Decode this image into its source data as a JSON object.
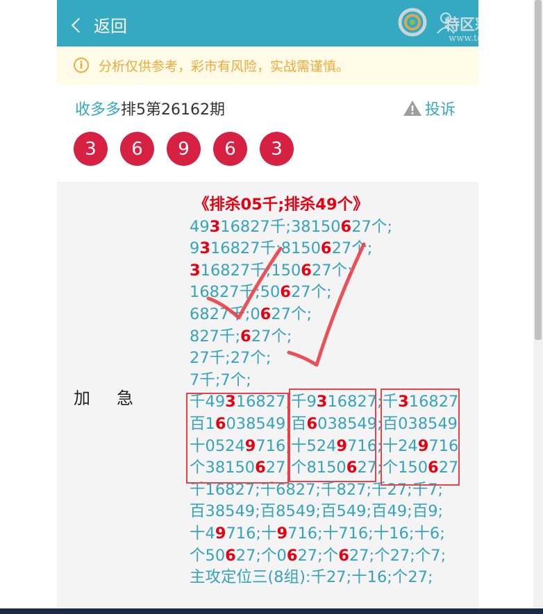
{
  "header": {
    "back_label": "返回",
    "logo_text": "特区彩票网",
    "logo_url": "www.tqcp.net"
  },
  "notice": {
    "icon": "info-icon",
    "text": "分析仅供参考，彩市有风险，实战需谨慎。"
  },
  "post": {
    "author": "收多多",
    "issue": "排5第26162期",
    "report_label": "投诉",
    "report_icon": "warning-icon"
  },
  "balls": [
    "3",
    "6",
    "9",
    "6",
    "3"
  ],
  "colors": {
    "header": "#35a9c1",
    "ball": "#d72143",
    "highlight": "#e60012",
    "text": "#36a3bb"
  },
  "content": {
    "label": "加急",
    "heading": "《排杀05千;排杀49个》",
    "lines": [
      [
        [
          "49",
          ""
        ],
        [
          "3",
          "r"
        ],
        [
          "16827千;38150",
          ""
        ],
        [
          "6",
          "r"
        ],
        [
          "27个;",
          ""
        ]
      ],
      [
        [
          "9",
          ""
        ],
        [
          "3",
          "r"
        ],
        [
          "16827千;8150",
          ""
        ],
        [
          "6",
          "r"
        ],
        [
          "27个;",
          ""
        ]
      ],
      [
        [
          "3",
          "r"
        ],
        [
          "16827千;150",
          ""
        ],
        [
          "6",
          "r"
        ],
        [
          "27个;",
          ""
        ]
      ],
      [
        [
          "16827千;50",
          ""
        ],
        [
          "6",
          "r"
        ],
        [
          "27个;",
          ""
        ]
      ],
      [
        [
          "6827千;0",
          ""
        ],
        [
          "6",
          "r"
        ],
        [
          "27个;",
          ""
        ]
      ],
      [
        [
          "827千;",
          ""
        ],
        [
          "6",
          "r"
        ],
        [
          "27个;",
          ""
        ]
      ],
      [
        [
          "27千;27个;",
          ""
        ]
      ],
      [
        [
          "7千;7个;",
          ""
        ]
      ],
      [
        [
          "千49",
          ""
        ],
        [
          "3",
          "r"
        ],
        [
          "16827;千9",
          ""
        ],
        [
          "3",
          "r"
        ],
        [
          "16827;千",
          ""
        ],
        [
          "3",
          "r"
        ],
        [
          "16827",
          ""
        ]
      ],
      [
        [
          "百1",
          ""
        ],
        [
          "6",
          "r"
        ],
        [
          "038549;百",
          ""
        ],
        [
          "6",
          "r"
        ],
        [
          "038549;百038549",
          ""
        ]
      ],
      [
        [
          "十0524",
          ""
        ],
        [
          "9",
          "r"
        ],
        [
          "716;十524",
          ""
        ],
        [
          "9",
          "r"
        ],
        [
          "716;十24",
          ""
        ],
        [
          "9",
          "r"
        ],
        [
          "716",
          ""
        ]
      ],
      [
        [
          "个38150",
          ""
        ],
        [
          "6",
          "r"
        ],
        [
          "27;个8150",
          ""
        ],
        [
          "6",
          "r"
        ],
        [
          "27;个150",
          ""
        ],
        [
          "6",
          "r"
        ],
        [
          "27",
          ""
        ]
      ],
      [
        [
          "千16827;千6827;千827;千27;千7;",
          ""
        ]
      ],
      [
        [
          "百38549;百8549;百549;百49;百9;",
          ""
        ]
      ],
      [
        [
          "十4",
          ""
        ],
        [
          "9",
          "r"
        ],
        [
          "716;十",
          ""
        ],
        [
          "9",
          "r"
        ],
        [
          "716;十716;十16;十6;",
          ""
        ]
      ],
      [
        [
          "个50",
          ""
        ],
        [
          "6",
          "r"
        ],
        [
          "27;个0",
          ""
        ],
        [
          "6",
          "r"
        ],
        [
          "27;个",
          ""
        ],
        [
          "6",
          "r"
        ],
        [
          "27;个27;个7;",
          ""
        ]
      ],
      [
        [
          "主攻定位三(8组):千27;十16;个27;",
          ""
        ]
      ]
    ]
  }
}
